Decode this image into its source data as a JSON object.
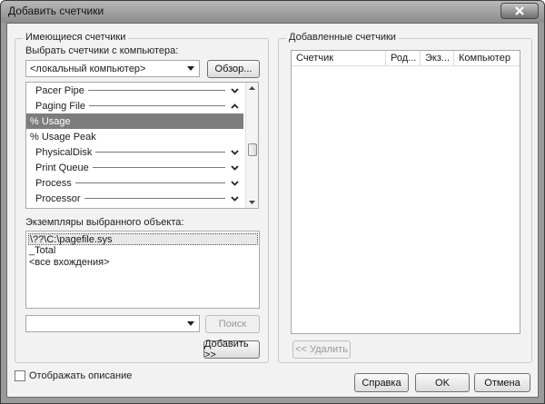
{
  "window": {
    "title": "Добавить счетчики"
  },
  "available": {
    "group_title": "Имеющиеся счетчики",
    "computer_label": "Выбрать счетчики с компьютера:",
    "computer_value": "<локальный компьютер>",
    "browse_label": "Обзор...",
    "counters": [
      {
        "label": "Pacer Pipe",
        "kind": "category",
        "chevron": "down"
      },
      {
        "label": "Paging File",
        "kind": "category",
        "chevron": "up"
      },
      {
        "label": "% Usage",
        "kind": "item",
        "selected": true
      },
      {
        "label": "% Usage Peak",
        "kind": "item"
      },
      {
        "label": "PhysicalDisk",
        "kind": "category",
        "chevron": "down"
      },
      {
        "label": "Print Queue",
        "kind": "category",
        "chevron": "down"
      },
      {
        "label": "Process",
        "kind": "category",
        "chevron": "down"
      },
      {
        "label": "Processor",
        "kind": "category",
        "chevron": "down"
      }
    ],
    "instances_label": "Экземпляры выбранного объекта:",
    "instances": [
      "\\??\\C:\\pagefile.sys",
      "_Total",
      "<все вхождения>"
    ],
    "search_value": "",
    "search_button": "Поиск",
    "add_button": "Добавить >>"
  },
  "added": {
    "group_title": "Добавленные счетчики",
    "columns": [
      "Счетчик",
      "Род...",
      "Экз...",
      "Компьютер"
    ],
    "rows": [],
    "remove_button": "<< Удалить"
  },
  "footer": {
    "show_description_label": "Отображать описание",
    "show_description_checked": false,
    "help_button": "Справка",
    "ok_button": "OK",
    "cancel_button": "Отмена"
  },
  "colors": {
    "selection": "#7d7d7d",
    "dialog_bg": "#f2f2f2"
  }
}
